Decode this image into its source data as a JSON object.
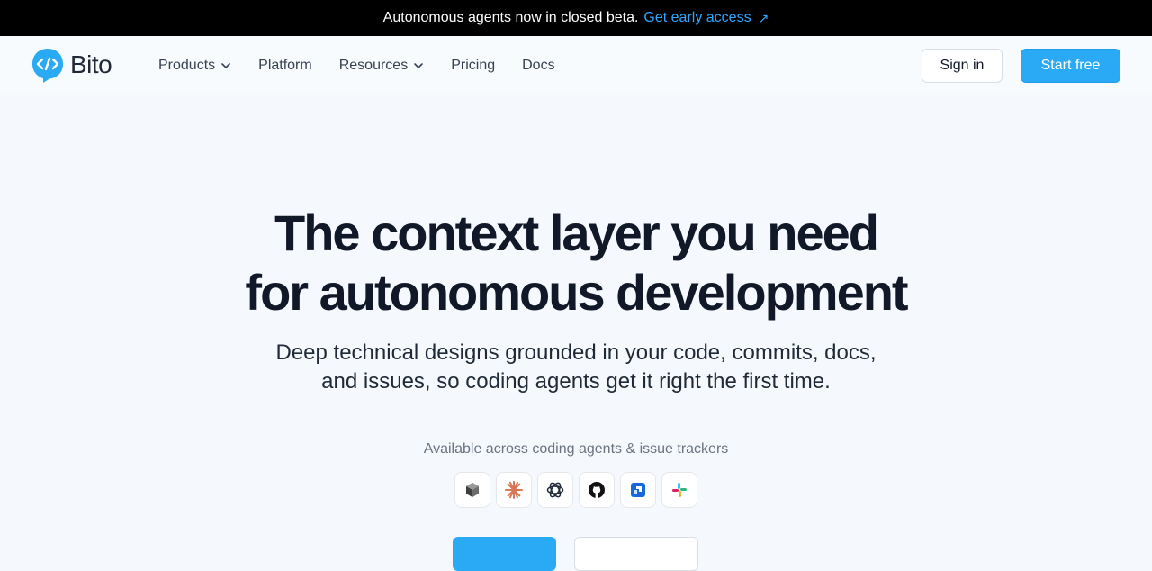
{
  "announcement": {
    "text": "Autonomous agents now in closed beta.",
    "link_label": "Get early access",
    "arrow": "↗"
  },
  "header": {
    "logo_text": "Bito",
    "nav": [
      {
        "label": "Products",
        "has_dropdown": true
      },
      {
        "label": "Platform",
        "has_dropdown": false
      },
      {
        "label": "Resources",
        "has_dropdown": true
      },
      {
        "label": "Pricing",
        "has_dropdown": false
      },
      {
        "label": "Docs",
        "has_dropdown": false
      }
    ],
    "signin_label": "Sign in",
    "start_label": "Start free"
  },
  "hero": {
    "title_line1": "The context layer you need",
    "title_line2": "for autonomous development",
    "subtitle_line1": "Deep technical designs grounded in your code, commits, docs,",
    "subtitle_line2": "and issues, so coding agents get it right the first time.",
    "available_text": "Available across coding agents & issue trackers",
    "integrations": [
      "cube-icon",
      "claude-icon",
      "openai-icon",
      "github-icon",
      "jira-icon",
      "slack-icon"
    ]
  },
  "colors": {
    "accent": "#2aa9f5",
    "link": "#2ea8ff",
    "background": "#f5f9fd"
  }
}
